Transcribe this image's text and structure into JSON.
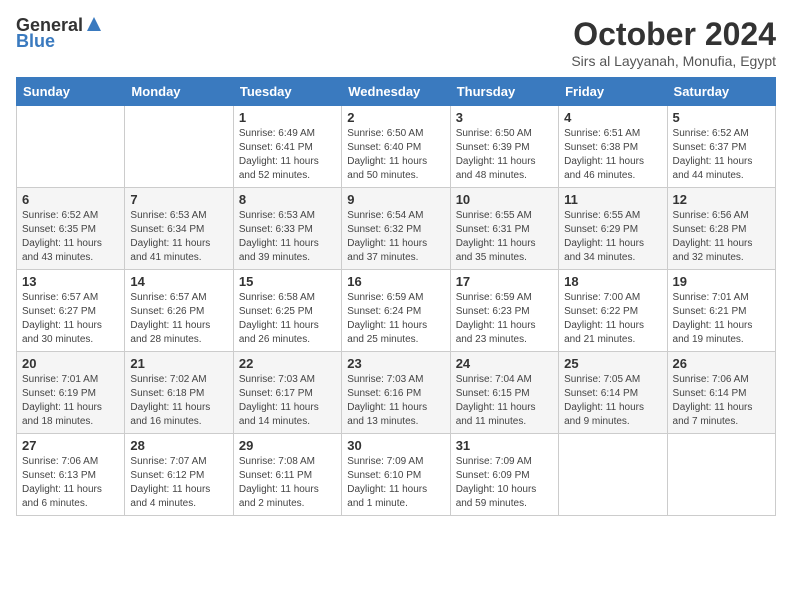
{
  "logo": {
    "general": "General",
    "blue": "Blue"
  },
  "title": "October 2024",
  "location": "Sirs al Layyanah, Monufia, Egypt",
  "days_of_week": [
    "Sunday",
    "Monday",
    "Tuesday",
    "Wednesday",
    "Thursday",
    "Friday",
    "Saturday"
  ],
  "weeks": [
    [
      {
        "num": "",
        "info": ""
      },
      {
        "num": "",
        "info": ""
      },
      {
        "num": "1",
        "info": "Sunrise: 6:49 AM\nSunset: 6:41 PM\nDaylight: 11 hours and 52 minutes."
      },
      {
        "num": "2",
        "info": "Sunrise: 6:50 AM\nSunset: 6:40 PM\nDaylight: 11 hours and 50 minutes."
      },
      {
        "num": "3",
        "info": "Sunrise: 6:50 AM\nSunset: 6:39 PM\nDaylight: 11 hours and 48 minutes."
      },
      {
        "num": "4",
        "info": "Sunrise: 6:51 AM\nSunset: 6:38 PM\nDaylight: 11 hours and 46 minutes."
      },
      {
        "num": "5",
        "info": "Sunrise: 6:52 AM\nSunset: 6:37 PM\nDaylight: 11 hours and 44 minutes."
      }
    ],
    [
      {
        "num": "6",
        "info": "Sunrise: 6:52 AM\nSunset: 6:35 PM\nDaylight: 11 hours and 43 minutes."
      },
      {
        "num": "7",
        "info": "Sunrise: 6:53 AM\nSunset: 6:34 PM\nDaylight: 11 hours and 41 minutes."
      },
      {
        "num": "8",
        "info": "Sunrise: 6:53 AM\nSunset: 6:33 PM\nDaylight: 11 hours and 39 minutes."
      },
      {
        "num": "9",
        "info": "Sunrise: 6:54 AM\nSunset: 6:32 PM\nDaylight: 11 hours and 37 minutes."
      },
      {
        "num": "10",
        "info": "Sunrise: 6:55 AM\nSunset: 6:31 PM\nDaylight: 11 hours and 35 minutes."
      },
      {
        "num": "11",
        "info": "Sunrise: 6:55 AM\nSunset: 6:29 PM\nDaylight: 11 hours and 34 minutes."
      },
      {
        "num": "12",
        "info": "Sunrise: 6:56 AM\nSunset: 6:28 PM\nDaylight: 11 hours and 32 minutes."
      }
    ],
    [
      {
        "num": "13",
        "info": "Sunrise: 6:57 AM\nSunset: 6:27 PM\nDaylight: 11 hours and 30 minutes."
      },
      {
        "num": "14",
        "info": "Sunrise: 6:57 AM\nSunset: 6:26 PM\nDaylight: 11 hours and 28 minutes."
      },
      {
        "num": "15",
        "info": "Sunrise: 6:58 AM\nSunset: 6:25 PM\nDaylight: 11 hours and 26 minutes."
      },
      {
        "num": "16",
        "info": "Sunrise: 6:59 AM\nSunset: 6:24 PM\nDaylight: 11 hours and 25 minutes."
      },
      {
        "num": "17",
        "info": "Sunrise: 6:59 AM\nSunset: 6:23 PM\nDaylight: 11 hours and 23 minutes."
      },
      {
        "num": "18",
        "info": "Sunrise: 7:00 AM\nSunset: 6:22 PM\nDaylight: 11 hours and 21 minutes."
      },
      {
        "num": "19",
        "info": "Sunrise: 7:01 AM\nSunset: 6:21 PM\nDaylight: 11 hours and 19 minutes."
      }
    ],
    [
      {
        "num": "20",
        "info": "Sunrise: 7:01 AM\nSunset: 6:19 PM\nDaylight: 11 hours and 18 minutes."
      },
      {
        "num": "21",
        "info": "Sunrise: 7:02 AM\nSunset: 6:18 PM\nDaylight: 11 hours and 16 minutes."
      },
      {
        "num": "22",
        "info": "Sunrise: 7:03 AM\nSunset: 6:17 PM\nDaylight: 11 hours and 14 minutes."
      },
      {
        "num": "23",
        "info": "Sunrise: 7:03 AM\nSunset: 6:16 PM\nDaylight: 11 hours and 13 minutes."
      },
      {
        "num": "24",
        "info": "Sunrise: 7:04 AM\nSunset: 6:15 PM\nDaylight: 11 hours and 11 minutes."
      },
      {
        "num": "25",
        "info": "Sunrise: 7:05 AM\nSunset: 6:14 PM\nDaylight: 11 hours and 9 minutes."
      },
      {
        "num": "26",
        "info": "Sunrise: 7:06 AM\nSunset: 6:14 PM\nDaylight: 11 hours and 7 minutes."
      }
    ],
    [
      {
        "num": "27",
        "info": "Sunrise: 7:06 AM\nSunset: 6:13 PM\nDaylight: 11 hours and 6 minutes."
      },
      {
        "num": "28",
        "info": "Sunrise: 7:07 AM\nSunset: 6:12 PM\nDaylight: 11 hours and 4 minutes."
      },
      {
        "num": "29",
        "info": "Sunrise: 7:08 AM\nSunset: 6:11 PM\nDaylight: 11 hours and 2 minutes."
      },
      {
        "num": "30",
        "info": "Sunrise: 7:09 AM\nSunset: 6:10 PM\nDaylight: 11 hours and 1 minute."
      },
      {
        "num": "31",
        "info": "Sunrise: 7:09 AM\nSunset: 6:09 PM\nDaylight: 10 hours and 59 minutes."
      },
      {
        "num": "",
        "info": ""
      },
      {
        "num": "",
        "info": ""
      }
    ]
  ]
}
